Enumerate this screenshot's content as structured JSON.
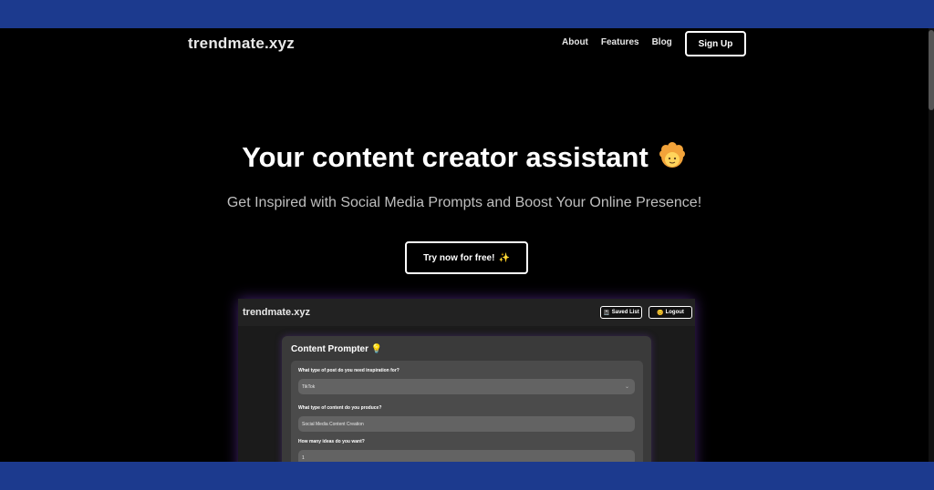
{
  "nav": {
    "brand": "trendmate.xyz",
    "links": [
      "About",
      "Features",
      "Blog"
    ],
    "signup": "Sign Up"
  },
  "hero": {
    "title": "Your content creator assistant",
    "title_emoji": "person-emoji-icon",
    "subtitle": "Get Inspired with Social Media Prompts and Boost Your Online Presence!",
    "cta": "Try now for free!",
    "cta_emoji": "✨"
  },
  "app": {
    "brand": "trendmate.xyz",
    "saved_label": "Saved List",
    "saved_icon": "📓",
    "logout_label": "Logout",
    "logout_icon": "😊",
    "card_title": "Content Prompter 💡",
    "form": {
      "q1_label": "What type of post do you need inspiration for?",
      "q1_value": "TikTok",
      "q2_label": "What type of content do you produce?",
      "q2_value": "Social Media Content Creation",
      "q3_label": "How many ideas do you want?",
      "q3_value": "1"
    }
  },
  "colors": {
    "frame_blue": "#1c3a8e",
    "page_bg": "#000000",
    "glow": "#7a3cc8"
  }
}
